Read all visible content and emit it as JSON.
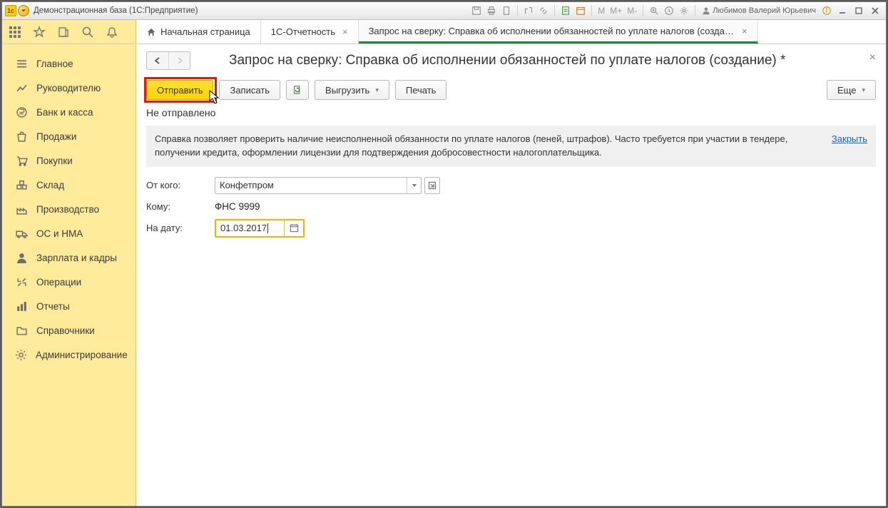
{
  "titlebar": {
    "title": "Демонстрационная база  (1С:Предприятие)",
    "user": "Любимов Валерий Юрьевич",
    "m_items": [
      "M",
      "M+",
      "M-"
    ]
  },
  "tabs": {
    "home": "Начальная страница",
    "t1": "1С-Отчетность",
    "t2": "Запрос на сверку: Справка об исполнении обязанностей по уплате налогов (создание) *"
  },
  "sidebar": {
    "items": [
      {
        "label": "Главное"
      },
      {
        "label": "Руководителю"
      },
      {
        "label": "Банк и касса"
      },
      {
        "label": "Продажи"
      },
      {
        "label": "Покупки"
      },
      {
        "label": "Склад"
      },
      {
        "label": "Производство"
      },
      {
        "label": "ОС и НМА"
      },
      {
        "label": "Зарплата и кадры"
      },
      {
        "label": "Операции"
      },
      {
        "label": "Отчеты"
      },
      {
        "label": "Справочники"
      },
      {
        "label": "Администрирование"
      }
    ]
  },
  "page": {
    "title": "Запрос на сверку: Справка об исполнении обязанностей по уплате налогов (создание) *",
    "buttons": {
      "send": "Отправить",
      "write": "Записать",
      "unload": "Выгрузить",
      "print": "Печать",
      "more": "Еще"
    },
    "status": "Не отправлено",
    "info": "Справка позволяет проверить наличие неисполненной обязанности по уплате налогов (пеней, штрафов). Часто требуется при участии в тендере, получении кредита, оформлении лицензии для подтверждения добросовестности налогоплательщика.",
    "close_link": "Закрыть",
    "form": {
      "from_label": "От кого:",
      "from_value": "Конфетпром",
      "to_label": "Кому:",
      "to_value": "ФНС 9999",
      "date_label": "На дату:",
      "date_value": "01.03.2017"
    }
  }
}
